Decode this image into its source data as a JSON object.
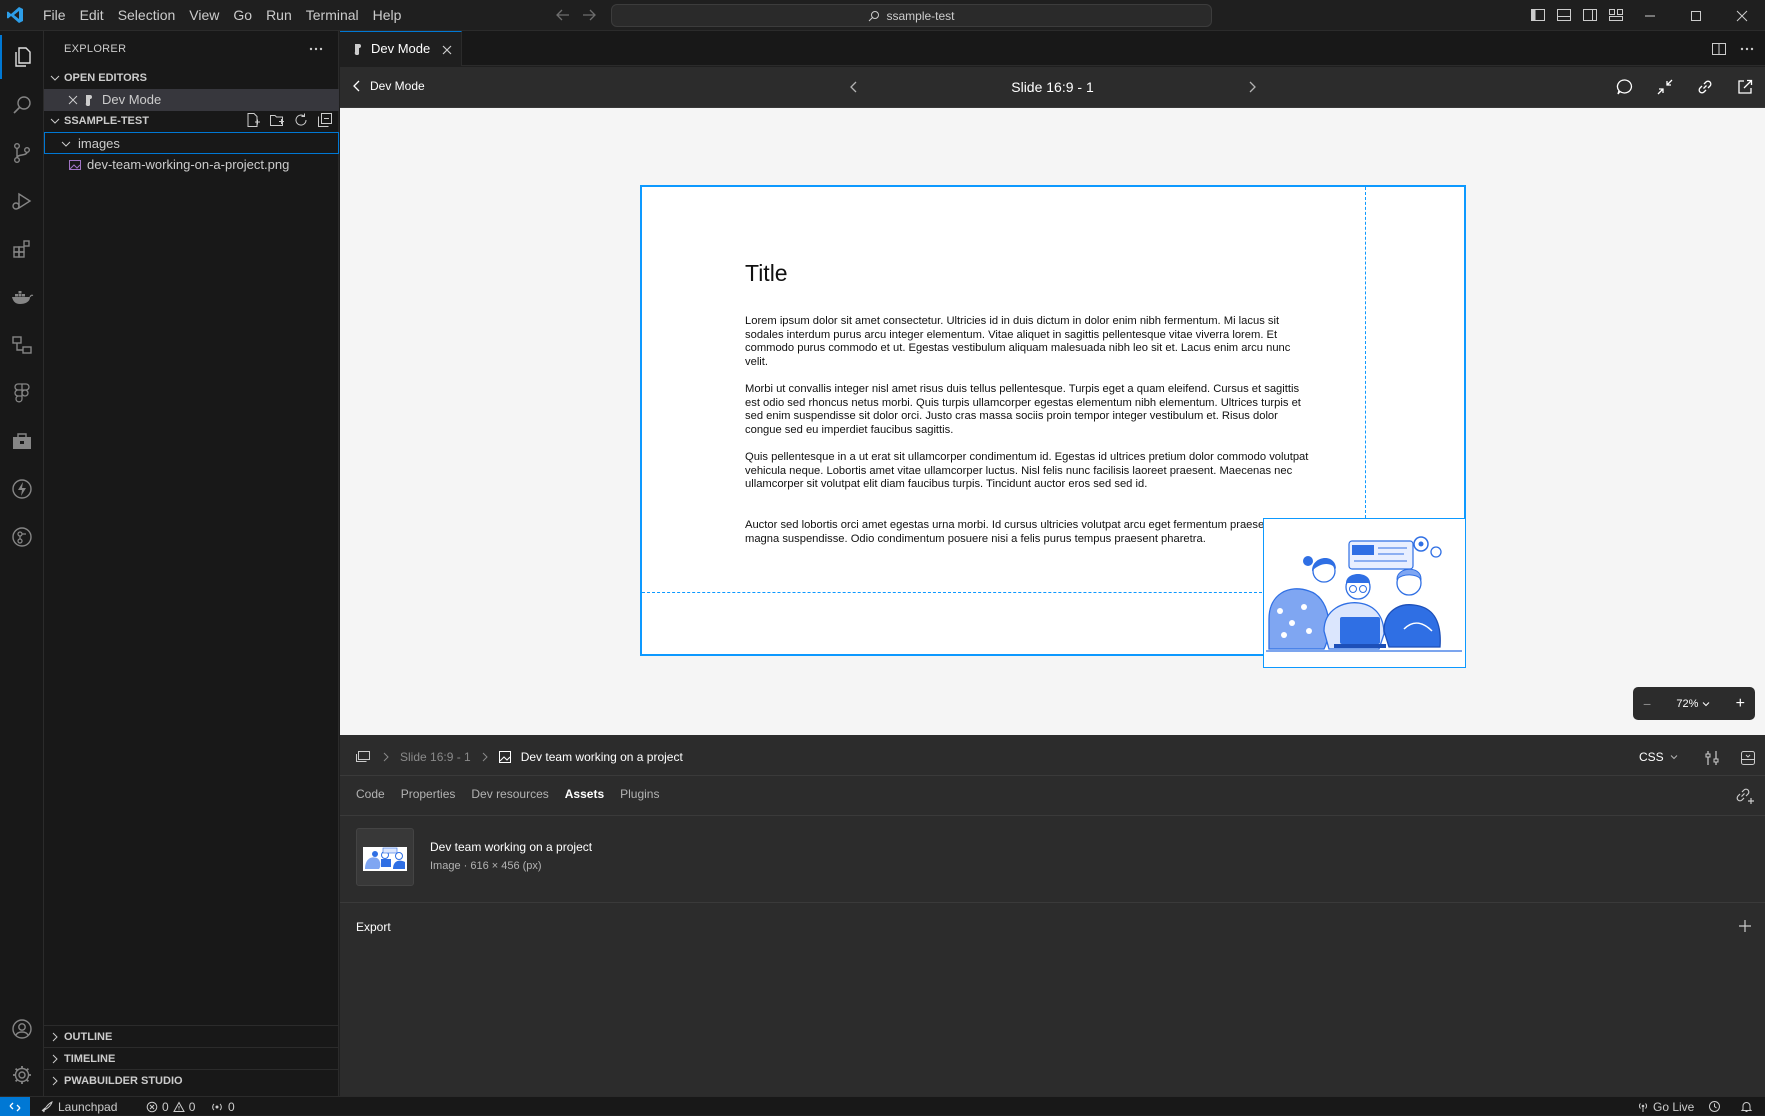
{
  "menu": [
    "File",
    "Edit",
    "Selection",
    "View",
    "Go",
    "Run",
    "Terminal",
    "Help"
  ],
  "search": {
    "text": "ssample-test"
  },
  "sidebar": {
    "title": "EXPLORER",
    "open_editors_label": "OPEN EDITORS",
    "open_editor_item": "Dev Mode",
    "project_label": "SSAMPLE-TEST",
    "folder": "images",
    "file": "dev-team-working-on-a-project.png",
    "outline_label": "OUTLINE",
    "timeline_label": "TIMELINE",
    "pwabuilder_label": "PWABUILDER STUDIO"
  },
  "tab": {
    "label": "Dev Mode"
  },
  "devbar": {
    "back_label": "Dev Mode",
    "slide_title": "Slide 16:9 - 1"
  },
  "slide": {
    "title": "Title",
    "paragraphs": [
      "Lorem ipsum dolor sit amet consectetur. Ultricies id in duis dictum in dolor enim nibh fermentum. Mi lacus sit sodales interdum purus arcu integer elementum. Vitae aliquet in sagittis pellentesque vitae viverra lorem. Et commodo purus commodo et ut. Egestas vestibulum aliquam malesuada nibh leo sit et. Lacus enim arcu nunc velit.",
      "Morbi ut convallis integer nisl amet risus duis tellus pellentesque. Turpis eget a quam eleifend. Cursus et sagittis est odio sed rhoncus netus morbi. Quis turpis ullamcorper egestas elementum nibh elementum. Ultrices turpis et sed enim suspendisse sit dolor orci. Justo cras massa sociis proin tempor integer vestibulum et. Risus dolor congue sed eu imperdiet faucibus sagittis.",
      "Quis pellentesque in a ut erat sit ullamcorper condimentum id. Egestas id ultrices pretium dolor commodo volutpat vehicula neque. Lobortis amet vitae ullamcorper luctus. Nisl felis nunc facilisis laoreet praesent. Maecenas nec ullamcorper sit volutpat elit diam faucibus turpis. Tincidunt auctor eros sed sed id.",
      "Auctor sed lobortis orci amet egestas urna morbi. Id cursus ultricies volutpat arcu eget fermentum praesent magna suspendisse. Odio condimentum posuere nisi a felis purus tempus praesent pharetra."
    ]
  },
  "zoom": {
    "value": "72%"
  },
  "inspect": {
    "breadcrumb_parent": "Slide 16:9 - 1",
    "breadcrumb_current": "Dev team working on a project",
    "language": "CSS",
    "tabs": [
      "Code",
      "Properties",
      "Dev resources",
      "Assets",
      "Plugins"
    ],
    "active_tab": "Assets",
    "asset_name": "Dev team working on a project",
    "asset_meta": "Image · 616 × 456 (px)",
    "export_label": "Export"
  },
  "statusbar": {
    "launchpad": "Launchpad",
    "errors": "0",
    "warnings": "0",
    "ports": "0",
    "go_live": "Go Live"
  },
  "colors": {
    "accent": "#0078d4",
    "figma_selection": "#0d99ff"
  }
}
